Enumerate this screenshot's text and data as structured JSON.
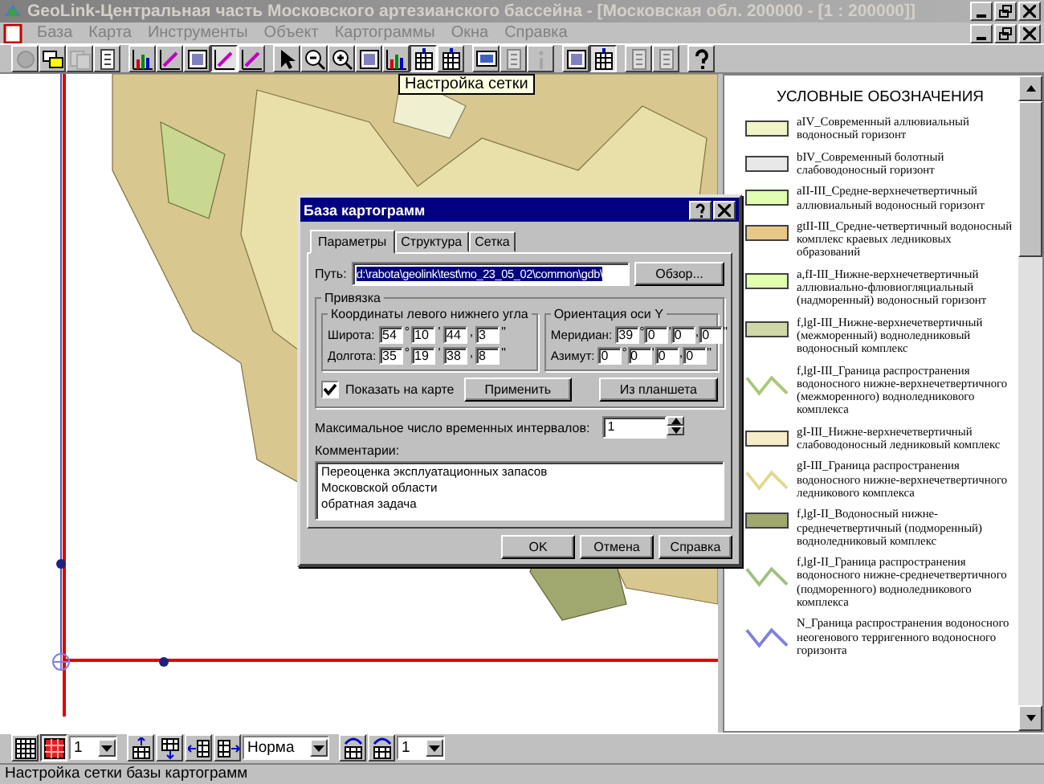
{
  "window": {
    "title": "GeoLink-Центральная часть Московского артезианского бассейна - [Московская обл. 200000 - [1 : 200000]]"
  },
  "menu": [
    "База",
    "Карта",
    "Инструменты",
    "Объект",
    "Картограммы",
    "Окна",
    "Справка"
  ],
  "toolbar": [
    {
      "kind": "globe",
      "pressed": false,
      "disabled": true
    },
    {
      "kind": "layers",
      "pressed": false,
      "disabled": false
    },
    {
      "kind": "copy",
      "pressed": false,
      "disabled": true
    },
    {
      "kind": "page",
      "pressed": false,
      "disabled": false
    },
    {
      "kind": "chart",
      "pressed": false,
      "disabled": false
    },
    {
      "kind": "pencil",
      "pressed": false,
      "disabled": false
    },
    {
      "kind": "frame",
      "pressed": false,
      "disabled": false
    },
    {
      "kind": "pencil",
      "pressed": true,
      "disabled": false
    },
    {
      "kind": "pencil",
      "pressed": false,
      "disabled": false
    },
    {
      "kind": "cursor",
      "pressed": false,
      "disabled": false
    },
    {
      "kind": "zoomout",
      "pressed": false,
      "disabled": false
    },
    {
      "kind": "zoomin",
      "pressed": false,
      "disabled": false
    },
    {
      "kind": "frame",
      "pressed": false,
      "disabled": false
    },
    {
      "kind": "chart",
      "pressed": false,
      "disabled": false
    },
    {
      "kind": "grid",
      "pressed": true,
      "disabled": false
    },
    {
      "kind": "grid",
      "pressed": false,
      "disabled": false
    },
    {
      "kind": "screen",
      "pressed": false,
      "disabled": false
    },
    {
      "kind": "page",
      "pressed": false,
      "disabled": true
    },
    {
      "kind": "info",
      "pressed": false,
      "disabled": true
    },
    {
      "kind": "frame",
      "pressed": false,
      "disabled": false
    },
    {
      "kind": "grid",
      "pressed": true,
      "disabled": false
    },
    {
      "kind": "page",
      "pressed": false,
      "disabled": true
    },
    {
      "kind": "page",
      "pressed": false,
      "disabled": true
    },
    {
      "kind": "help",
      "pressed": false,
      "disabled": false
    }
  ],
  "tooltip": "Настройка сетки",
  "dialog": {
    "title": "База картограмм",
    "tabs": [
      {
        "label": "Параметры",
        "selected": true
      },
      {
        "label": "Структура",
        "selected": false
      },
      {
        "label": "Сетка",
        "selected": false
      }
    ],
    "path_label": "Путь:",
    "path": "d:\\rabota\\geolink\\test\\mo_23_05_02\\common\\gdb\\",
    "browse_button": "Обзор...",
    "binding_group": "Привязка",
    "coords_group": {
      "title": "Координаты левого нижнего угла",
      "rows": [
        {
          "label": "Широта:",
          "values": [
            "54",
            "10",
            "44",
            "3"
          ]
        },
        {
          "label": "Долгота:",
          "values": [
            "35",
            "19",
            "38",
            "8"
          ]
        }
      ]
    },
    "orient_group": {
      "title": "Ориентация оси Y",
      "rows": [
        {
          "label": "Меридиан:",
          "values": [
            "39",
            "0",
            "0",
            "0"
          ]
        },
        {
          "label": "Азимут:",
          "values": [
            "0",
            "0",
            "0",
            "0"
          ]
        }
      ]
    },
    "units": [
      "°",
      "'",
      ",",
      "\""
    ],
    "show_on_map": {
      "label": "Показать на карте",
      "checked": true
    },
    "apply_button": "Применить",
    "from_tablet_button": "Из планшета",
    "max_intervals_label": "Максимальное число временных интервалов:",
    "max_intervals": "1",
    "comments_label": "Комментарии:",
    "comments": [
      "Переоценка эксплуатационных запасов",
      "Московской области",
      "обратная задача"
    ],
    "buttons": [
      "OK",
      "Отмена",
      "Справка"
    ]
  },
  "legend": {
    "title": "УСЛОВНЫЕ ОБОЗНАЧЕНИЯ",
    "items": [
      {
        "kind": "fill",
        "color": "#f0f5c8",
        "text": "aIV_Современный аллювиальный водоносный горизонт"
      },
      {
        "kind": "fill",
        "color": "#e8e8e8",
        "text": "bIV_Современный болотный слабоводоносный горизонт"
      },
      {
        "kind": "fill",
        "color": "#e0ffb0",
        "text": "aII-III_Средне-верхнечетвертичный аллювиальный водоносный горизонт"
      },
      {
        "kind": "fill",
        "color": "#e8c888",
        "text": "gtII-III_Средне-четвертичный водоносный комплекс краевых ледниковых образований"
      },
      {
        "kind": "fill",
        "color": "#e0ffb1",
        "text": "a,fI-III_Нижне-верхнечетвертичный аллювиально-флювиогляциальный (надморенный) водоносный горизонт"
      },
      {
        "kind": "fill",
        "color": "#d0d8a8",
        "text": "f,lgI-III_Нижне-верхнечетвертичный (межморенный) водноледниковый водоносный комплекс"
      },
      {
        "kind": "line",
        "color": "#a8c878",
        "text": "f,lgI-III_Граница распространения водоносного нижне-верхнечетвертичного (межморенного) водноледникового комплекса"
      },
      {
        "kind": "fill",
        "color": "#f8ecc8",
        "text": "gI-III_Нижне-верхнечетвертичный слабоводоносный ледниковый комплекс"
      },
      {
        "kind": "line",
        "color": "#e0d890",
        "text": "gI-III_Граница распространения водоносного нижне-верхнечетвертичного ледникового комплекса"
      },
      {
        "kind": "fill",
        "color": "#a0a870",
        "text": "f,lgI-II_Водоносный нижне-среднечетвертичный (подморенный) водноледниковый комплекс"
      },
      {
        "kind": "line",
        "color": "#a0c080",
        "text": "f,lgI-II_Граница распространения водоносного нижне-среднечетвертичного (подморенного) водноледникового комплекса"
      },
      {
        "kind": "line",
        "color": "#8080e0",
        "text": "N_Граница распространения водоносного неогенового терригенного водоносного горизонта"
      }
    ]
  },
  "bottom_toolbar": {
    "combo_1": "1",
    "combo_2": "Норма",
    "combo_3": "1"
  },
  "status_bar": "Настройка сетки базы картограмм"
}
